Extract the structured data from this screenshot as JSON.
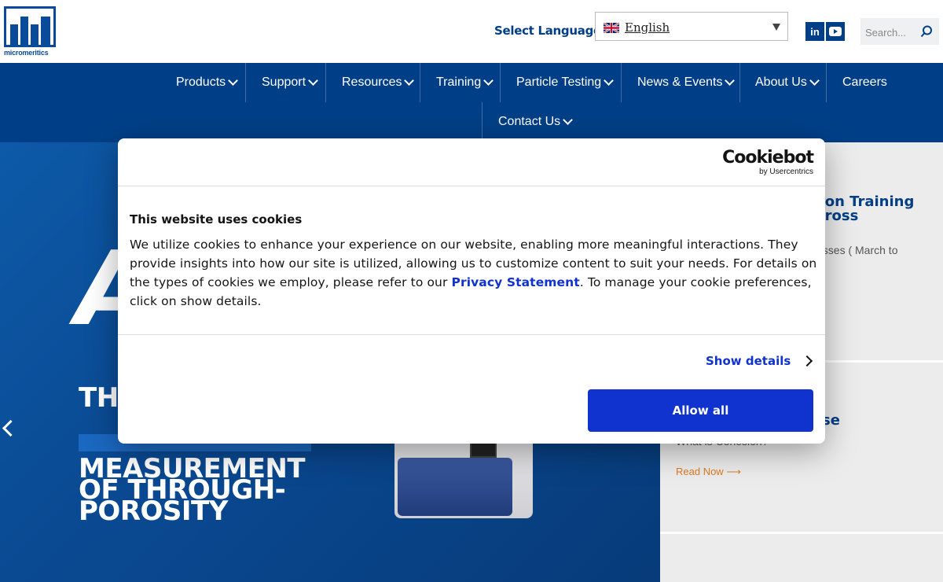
{
  "logo": {
    "wordmark": "micromeritics"
  },
  "header": {
    "select_language": "Select Language",
    "language": {
      "value": "English",
      "flag": "uk-flag-icon"
    },
    "social": [
      {
        "name": "linkedin-icon",
        "label": "in"
      },
      {
        "name": "youtube-icon",
        "label": "▶"
      }
    ],
    "search": {
      "placeholder": "Search..."
    }
  },
  "nav": {
    "items": [
      {
        "label": "Products",
        "has_dropdown": true
      },
      {
        "label": "Support",
        "has_dropdown": true
      },
      {
        "label": "Resources",
        "has_dropdown": true
      },
      {
        "label": "Training",
        "has_dropdown": true
      },
      {
        "label": "Particle Testing",
        "has_dropdown": true
      },
      {
        "label": "News & Events",
        "has_dropdown": true
      },
      {
        "label": "About Us",
        "has_dropdown": true
      },
      {
        "label": "Careers",
        "has_dropdown": false
      },
      {
        "label": "Contact Us",
        "has_dropdown": true
      }
    ]
  },
  "hero": {
    "big_letter": "A",
    "tagline_lines": [
      "THE",
      "MEASUREMENT",
      "OF THROUGH-",
      "POROSITY"
    ]
  },
  "sidebar": {
    "card1": {
      "title_lines": [
        "son Training",
        "cross"
      ],
      "text": "asses ( March to"
    },
    "card2": {
      "title": "se",
      "text": "What is Cohesion?",
      "read_more": "Read Now"
    }
  },
  "cookie_dialog": {
    "brand": "Cookiebot",
    "brand_sub": "by Usercentrics",
    "title": "This website uses cookies",
    "body_before_link": "We utilize cookies to enhance your experience on our website, enabling more meaningful interactions. They provide insights into how our site is utilized, allowing us to customize content to suit your needs. For details on the types of cookies we employ, please refer to our ",
    "link_text": "Privacy Statement",
    "body_after_link": ". To manage your cookie preferences, click on show details.",
    "show_details": "Show details",
    "allow_all": "Allow all"
  },
  "colors": {
    "brand_blue": "#003f87",
    "cookie_blue": "#1032cf",
    "accent_orange": "#e07b1f"
  }
}
